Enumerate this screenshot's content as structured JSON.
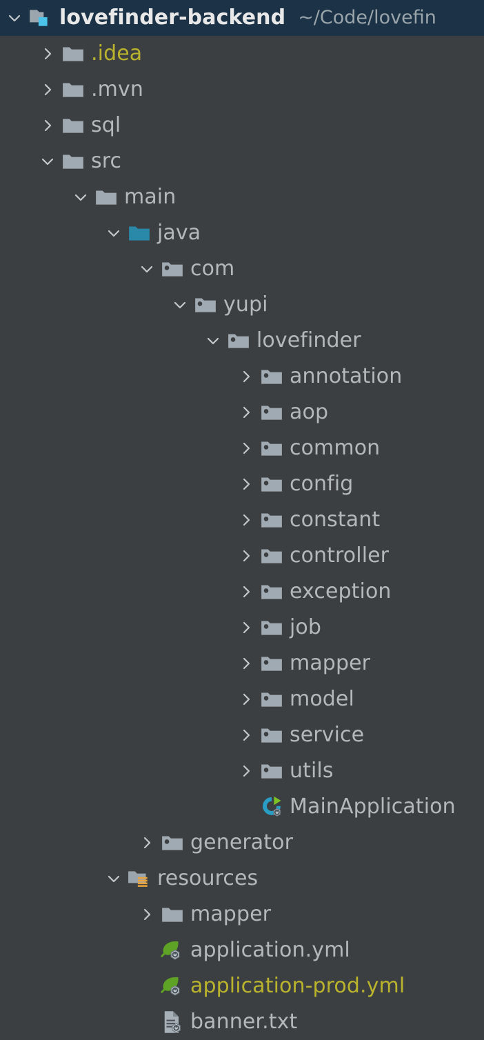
{
  "window": {
    "kind": "ide-project-tree",
    "background_color": "#3c3f41",
    "selection_color": "#1c3246",
    "text_color": "#b4b8bb",
    "ignored_text_color": "#b9b32e",
    "path_text_color": "#9aa4ab",
    "source_root_color": "#2a88a8",
    "resource_badge_color": "#e8a33d",
    "spring_green": "#5ea226",
    "class_blue": "#2a9dc4",
    "run_arrow_green": "#7cc224"
  },
  "tree": {
    "root": {
      "label": "lovefinder-backend",
      "path": "~/Code/lovefin",
      "icon": "project-root-folder-icon",
      "expanded": true,
      "selected": true,
      "indent": 0
    },
    "nodes": [
      {
        "label": ".idea",
        "icon": "folder-icon",
        "arrow": "collapsed",
        "indent": 1,
        "ignored": true
      },
      {
        "label": ".mvn",
        "icon": "folder-icon",
        "arrow": "collapsed",
        "indent": 1,
        "ignored": false
      },
      {
        "label": "sql",
        "icon": "folder-icon",
        "arrow": "collapsed",
        "indent": 1,
        "ignored": false
      },
      {
        "label": "src",
        "icon": "folder-icon",
        "arrow": "expanded",
        "indent": 1,
        "ignored": false
      },
      {
        "label": "main",
        "icon": "folder-icon",
        "arrow": "expanded",
        "indent": 2,
        "ignored": false
      },
      {
        "label": "java",
        "icon": "source-root-icon",
        "arrow": "expanded",
        "indent": 3,
        "ignored": false
      },
      {
        "label": "com",
        "icon": "package-icon",
        "arrow": "expanded",
        "indent": 4,
        "ignored": false
      },
      {
        "label": "yupi",
        "icon": "package-icon",
        "arrow": "expanded",
        "indent": 5,
        "ignored": false
      },
      {
        "label": "lovefinder",
        "icon": "package-icon",
        "arrow": "expanded",
        "indent": 6,
        "ignored": false
      },
      {
        "label": "annotation",
        "icon": "package-icon",
        "arrow": "collapsed",
        "indent": 7,
        "ignored": false
      },
      {
        "label": "aop",
        "icon": "package-icon",
        "arrow": "collapsed",
        "indent": 7,
        "ignored": false
      },
      {
        "label": "common",
        "icon": "package-icon",
        "arrow": "collapsed",
        "indent": 7,
        "ignored": false
      },
      {
        "label": "config",
        "icon": "package-icon",
        "arrow": "collapsed",
        "indent": 7,
        "ignored": false
      },
      {
        "label": "constant",
        "icon": "package-icon",
        "arrow": "collapsed",
        "indent": 7,
        "ignored": false
      },
      {
        "label": "controller",
        "icon": "package-icon",
        "arrow": "collapsed",
        "indent": 7,
        "ignored": false
      },
      {
        "label": "exception",
        "icon": "package-icon",
        "arrow": "collapsed",
        "indent": 7,
        "ignored": false
      },
      {
        "label": "job",
        "icon": "package-icon",
        "arrow": "collapsed",
        "indent": 7,
        "ignored": false
      },
      {
        "label": "mapper",
        "icon": "package-icon",
        "arrow": "collapsed",
        "indent": 7,
        "ignored": false
      },
      {
        "label": "model",
        "icon": "package-icon",
        "arrow": "collapsed",
        "indent": 7,
        "ignored": false
      },
      {
        "label": "service",
        "icon": "package-icon",
        "arrow": "collapsed",
        "indent": 7,
        "ignored": false
      },
      {
        "label": "utils",
        "icon": "package-icon",
        "arrow": "collapsed",
        "indent": 7,
        "ignored": false
      },
      {
        "label": "MainApplication",
        "icon": "spring-class-run-icon",
        "arrow": "none",
        "indent": 7,
        "ignored": false
      },
      {
        "label": "generator",
        "icon": "package-icon",
        "arrow": "collapsed",
        "indent": 4,
        "ignored": false
      },
      {
        "label": "resources",
        "icon": "resource-root-icon",
        "arrow": "expanded",
        "indent": 3,
        "ignored": false
      },
      {
        "label": "mapper",
        "icon": "folder-icon",
        "arrow": "collapsed",
        "indent": 4,
        "ignored": false
      },
      {
        "label": "application.yml",
        "icon": "spring-yaml-icon",
        "arrow": "none",
        "indent": 4,
        "ignored": false
      },
      {
        "label": "application-prod.yml",
        "icon": "spring-yaml-icon",
        "arrow": "none",
        "indent": 4,
        "ignored": true
      },
      {
        "label": "banner.txt",
        "icon": "text-config-file-icon",
        "arrow": "none",
        "indent": 4,
        "ignored": false
      }
    ]
  }
}
